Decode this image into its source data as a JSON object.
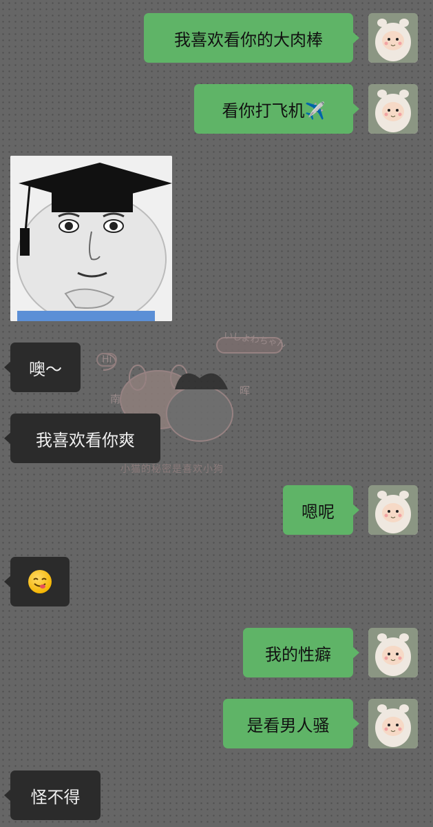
{
  "chat": {
    "wallpaper_caption": "小猫的秘密是喜欢小狗",
    "wallpaper_tag": "いしよわちゃん",
    "wallpaper_hi": "Hi",
    "wallpaper_left_name": "南",
    "wallpaper_right_name": "晖",
    "messages": [
      {
        "sender": "me",
        "text": "我喜欢看你的大肉棒"
      },
      {
        "sender": "me",
        "text": "看你打飞机✈️"
      },
      {
        "sender": "them",
        "type": "sticker",
        "sticker": "graduation-cap-meme-face"
      },
      {
        "sender": "them",
        "text": "噢～"
      },
      {
        "sender": "them",
        "text": "我喜欢看你爽"
      },
      {
        "sender": "me",
        "text": "嗯呢"
      },
      {
        "sender": "them",
        "type": "emoji",
        "emoji": "yum-face"
      },
      {
        "sender": "me",
        "text": "我的性癖"
      },
      {
        "sender": "me",
        "text": "是看男人骚"
      },
      {
        "sender": "them",
        "text": "怪不得"
      }
    ]
  },
  "colors": {
    "background": "#666666",
    "my_bubble": "#5fb467",
    "their_bubble": "#2b2b2b"
  }
}
